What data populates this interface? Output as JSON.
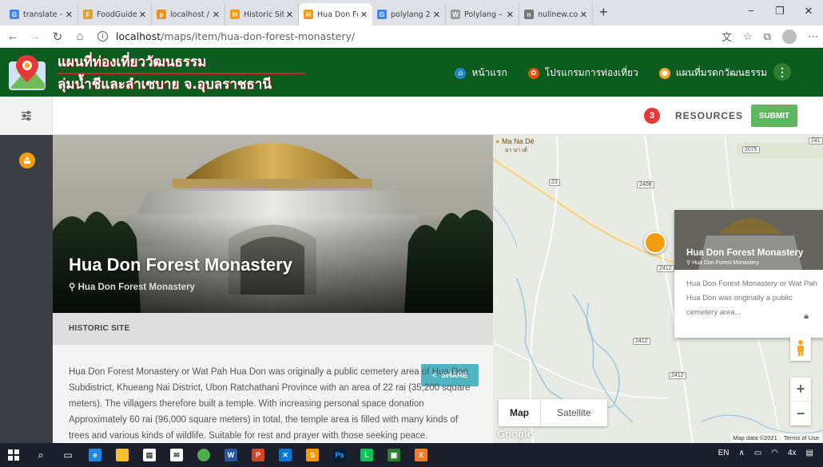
{
  "browser": {
    "tabs": [
      {
        "title": "translate - ค้นห",
        "fav_color": "#4285f4",
        "fav_glyph": "G"
      },
      {
        "title": "FoodGuide | D",
        "fav_color": "#e0a030",
        "fav_glyph": "F"
      },
      {
        "title": "localhost / 127",
        "fav_color": "#f29111",
        "fav_glyph": "p"
      },
      {
        "title": "Historic Site |",
        "fav_color": "#f39c12",
        "fav_glyph": "H"
      },
      {
        "title": "Hua Don Fore",
        "fav_color": "#f39c12",
        "fav_glyph": "H"
      },
      {
        "title": "polylang 2.9 -",
        "fav_color": "#4285f4",
        "fav_glyph": "G"
      },
      {
        "title": "Polylang – Wo",
        "fav_color": "#999999",
        "fav_glyph": "W"
      },
      {
        "title": "nullnew.com",
        "fav_color": "#777777",
        "fav_glyph": "n"
      }
    ],
    "active_tab": 4,
    "url_host": "localhost",
    "url_path": "/maps/item/hua-don-forest-monastery/"
  },
  "site": {
    "title_line1": "แผนที่ท่องเที่ยววัฒนธรรม",
    "title_line2": "ลุ่มน้ำชีและลำเซบาย จ.อุบลราชธานี",
    "nav": [
      {
        "label": "หน้าแรก",
        "color": "#1e88c9"
      },
      {
        "label": "โปรแกรมการท่องเที่ยว",
        "color": "#e65100"
      },
      {
        "label": "แผนที่มรดกวัฒนธรรม",
        "color": "#f9a825"
      }
    ],
    "kebab_glyph": "⋮"
  },
  "toolbar": {
    "resources_count": "3",
    "resources_label": "RESOURCES",
    "submit_label": "SUBMIT"
  },
  "place": {
    "title": "Hua Don Forest Monastery",
    "location": "Hua Don Forest Monastery",
    "category": "HISTORIC SITE",
    "share_label": "SHARE",
    "description": "Hua Don Forest Monastery or Wat Pah Hua Don was originally a public cemetery area of Hua Don Subdistrict, Khueang Nai District, Ubon Ratchathani Province with an area of 22 rai (35,200 square meters). The villagers therefore built a temple. With increasing personal space donation Approximately 60 rai (96,000 square meters) in total, the temple area is filled with many kinds of trees and various kinds of wildlife. Suitable for rest and prayer with those seeking peace."
  },
  "map": {
    "card_title": "Hua Don Forest Monastery",
    "card_sub": "Hua Don Forest Monastery",
    "card_desc": "Hua Don Forest Monastery or Wat Pah Hua Don was originally a public cemetery area...",
    "type_map": "Map",
    "type_satellite": "Satellite",
    "zoom_in": "+",
    "zoom_out": "−",
    "google": "Google",
    "attribution": "Map data ©2021",
    "terms": "Terms of Use",
    "place_name": "Ma Na Dé",
    "place_name_th": "มา นา เด้",
    "roads": [
      "2075",
      "23",
      "2408",
      "2412",
      "2412",
      "2412",
      "241"
    ]
  },
  "taskbar": {
    "lang": "EN",
    "tray_time": "4x"
  }
}
